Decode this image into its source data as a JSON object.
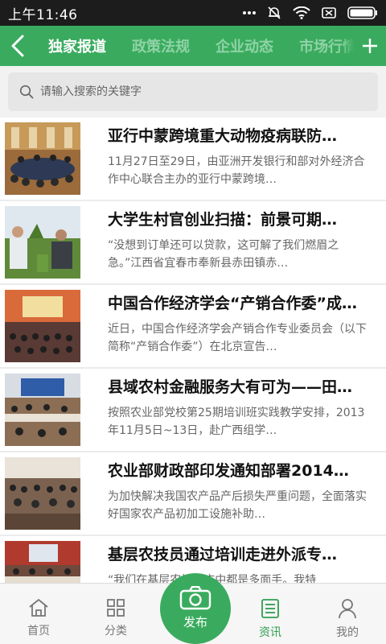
{
  "status": {
    "time": "上午11:46"
  },
  "tabs": [
    "独家报道",
    "政策法规",
    "企业动态",
    "市场行情"
  ],
  "search": {
    "placeholder": "请输入搜索的关键字"
  },
  "articles": [
    {
      "title": "亚行中蒙跨境重大动物疫病联防…",
      "desc": "11月27日至29日，由亚洲开发银行和部对外经济合作中心联合主办的亚行中蒙跨境…"
    },
    {
      "title": "大学生村官创业扫描：前景可期…",
      "desc": "“没想到订单还可以贷款，这可解了我们燃眉之急。”江西省宜春市奉新县赤田镇赤…"
    },
    {
      "title": "中国合作经济学会“产销合作委”成…",
      "desc": "近日，中国合作经济学会产销合作专业委员会（以下简称“产销合作委”）在北京宣告…"
    },
    {
      "title": "县域农村金融服务大有可为——田…",
      "desc": "按照农业部党校第25期培训班实践教学安排，2013年11月5日~13日，赴广西组学…"
    },
    {
      "title": "农业部财政部印发通知部署2014…",
      "desc": "为加快解决我国农产品产后损失严重问题，全面落实好国家农产品初加工设施补助…"
    },
    {
      "title": "基层农技员通过培训走进外派专…",
      "desc": "“我们在基层农技推广中都是多面手。我特"
    }
  ],
  "nav": {
    "home": "首页",
    "category": "分类",
    "publish": "发布",
    "news": "资讯",
    "mine": "我的"
  },
  "colors": {
    "primary": "#3aab5e",
    "tab_inactive": "#8fd3a6",
    "nav_active": "#2f9e50"
  },
  "icons": [
    "back-arrow-icon",
    "plus-icon",
    "search-icon",
    "home-icon",
    "grid-icon",
    "camera-icon",
    "news-icon",
    "user-icon"
  ]
}
